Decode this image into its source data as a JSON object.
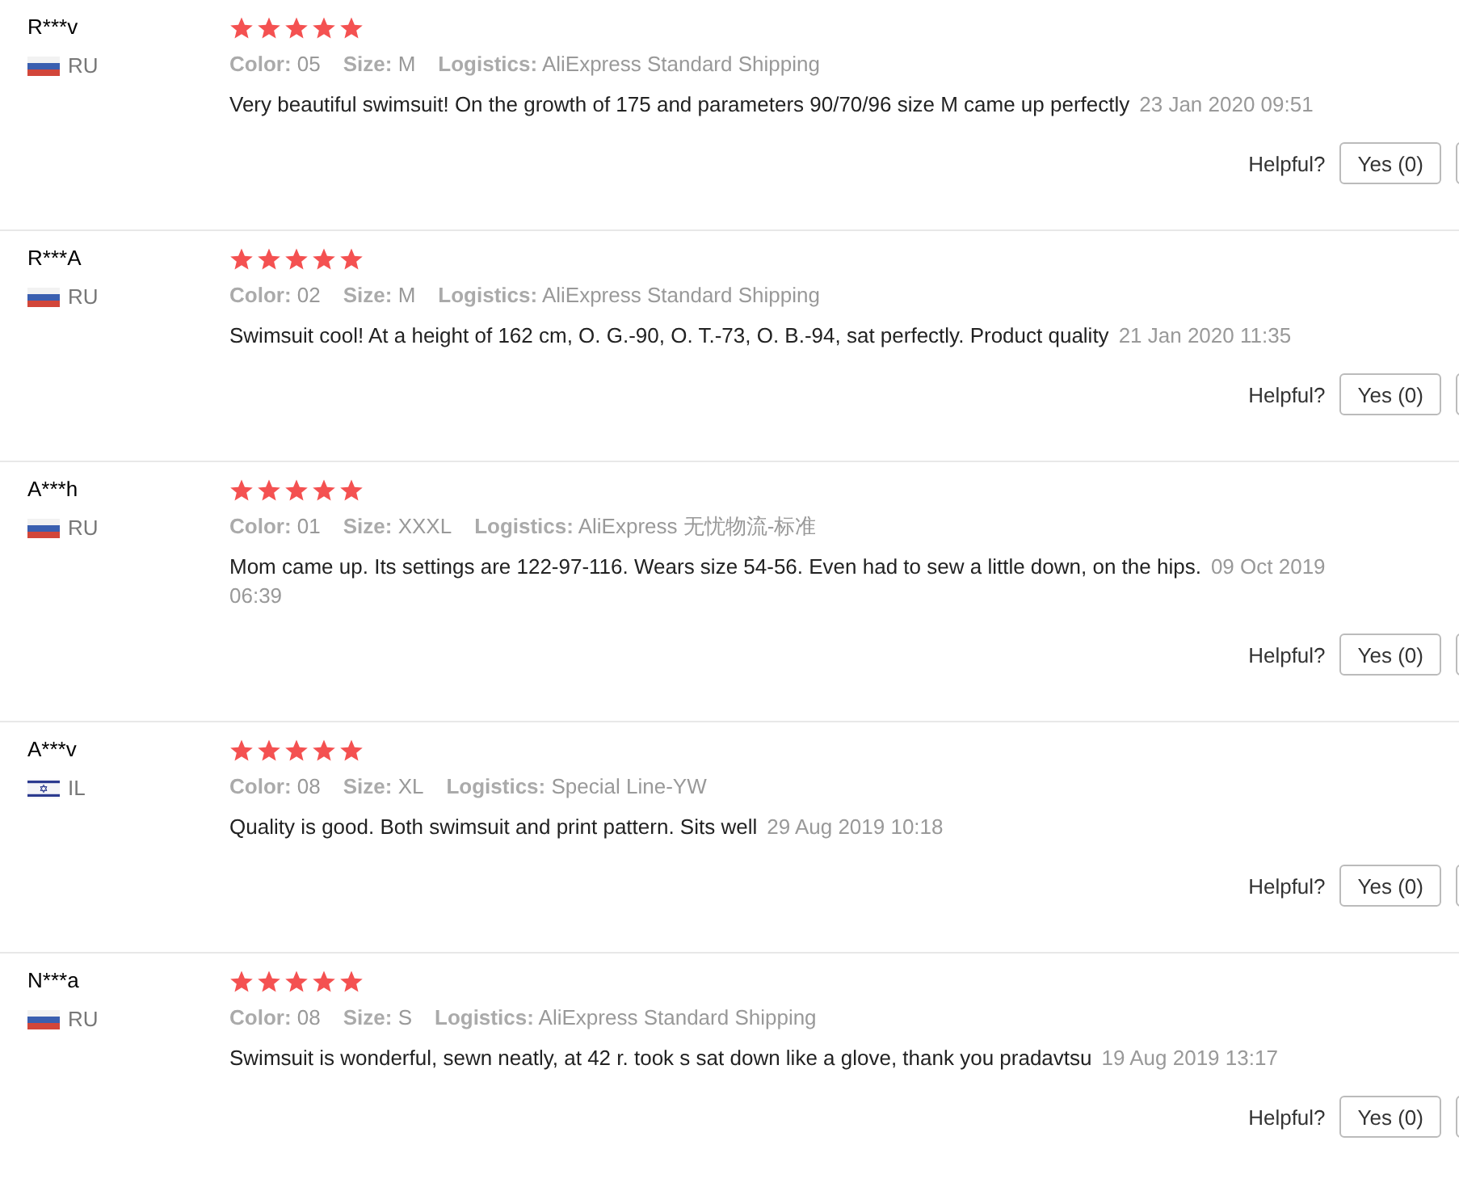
{
  "reviews": [
    {
      "user": "R***v",
      "country": "RU",
      "kind": "russia",
      "stars": 5,
      "color_label": "Color:",
      "color_value": "05",
      "size_label": "Size:",
      "size": "M",
      "logistics_label": "Logistics:",
      "logistics": "AliExpress Standard Shipping",
      "text": "Very beautiful swimsuit! On the growth of 175 and parameters 90/70/96 size M came up perfectly",
      "date": "23 Jan 2020 09:51",
      "helpful": "Helpful?",
      "yes": "Yes (0)"
    },
    {
      "user": "R***A",
      "country": "RU",
      "kind": "russia",
      "stars": 5,
      "color_label": "Color:",
      "color_value": "02",
      "size_label": "Size:",
      "size": "M",
      "logistics_label": "Logistics:",
      "logistics": "AliExpress Standard Shipping",
      "text": "Swimsuit cool! At a height of 162 cm, O. G.-90, O. T.-73, O. B.-94, sat perfectly. Product quality",
      "date": "21 Jan 2020 11:35",
      "helpful": "Helpful?",
      "yes": "Yes (0)"
    },
    {
      "user": "A***h",
      "country": "RU",
      "kind": "russia",
      "stars": 5,
      "color_label": "Color:",
      "color_value": "01",
      "size_label": "Size:",
      "size": "XXXL",
      "logistics_label": "Logistics:",
      "logistics": "AliExpress 无忧物流-标准",
      "text": "Mom came up. Its settings are 122-97-116. Wears size 54-56. Even had to sew a little down, on the hips.",
      "date": "09 Oct 2019 06:39",
      "helpful": "Helpful?",
      "yes": "Yes (0)"
    },
    {
      "user": "A***v",
      "country": "IL",
      "kind": "israel",
      "stars": 5,
      "color_label": "Color:",
      "color_value": "08",
      "size_label": "Size:",
      "size": "XL",
      "logistics_label": "Logistics:",
      "logistics": "Special Line-YW",
      "text": "Quality is good. Both swimsuit and print pattern. Sits well",
      "date": "29 Aug 2019 10:18",
      "helpful": "Helpful?",
      "yes": "Yes (0)"
    },
    {
      "user": "N***a",
      "country": "RU",
      "kind": "russia",
      "stars": 5,
      "color_label": "Color:",
      "color_value": "08",
      "size_label": "Size:",
      "size": "S",
      "logistics_label": "Logistics:",
      "logistics": "AliExpress Standard Shipping",
      "text": "Swimsuit is wonderful, sewn neatly, at 42 r. took s sat down like a glove, thank you pradavtsu",
      "date": "19 Aug 2019 13:17",
      "helpful": "Helpful?",
      "yes": "Yes (0)"
    }
  ]
}
